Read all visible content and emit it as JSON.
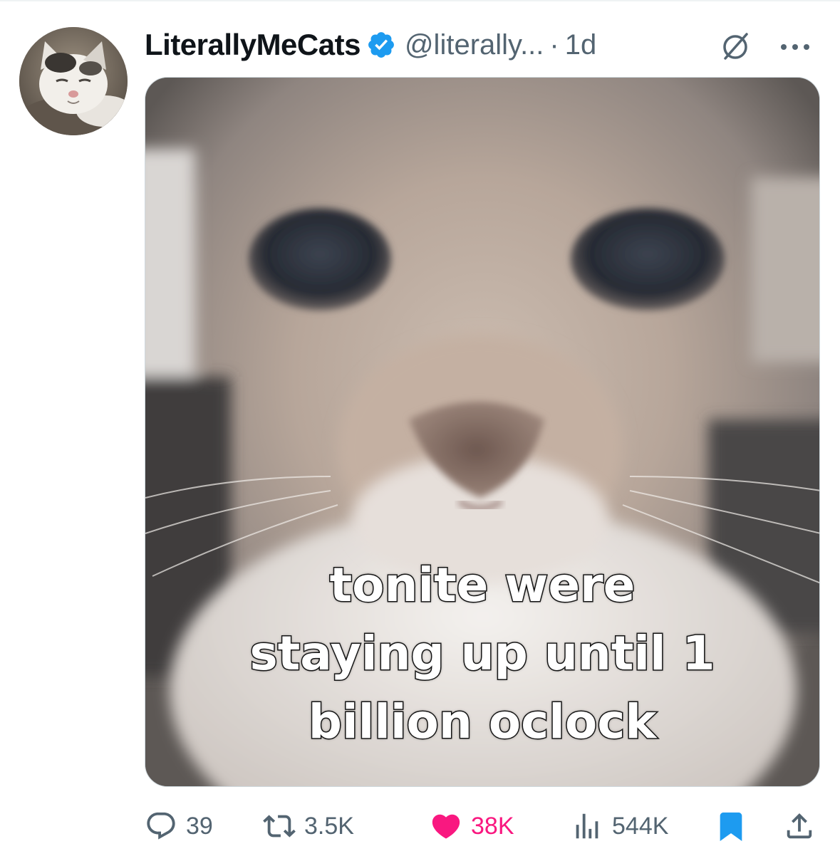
{
  "tweet": {
    "display_name": "LiterallyMeCats",
    "handle": "@literally...",
    "separator": "·",
    "time": "1d",
    "media_caption_lines": [
      "tonite were",
      "staying up until 1",
      "billion oclock"
    ]
  },
  "icons": {
    "verified": "verified-badge-icon",
    "grok": "grok-icon",
    "more": "more-options-icon",
    "reply": "reply-icon",
    "retweet": "retweet-icon",
    "like": "like-icon",
    "views": "views-icon",
    "bookmark": "bookmark-icon",
    "share": "share-icon"
  },
  "actions": {
    "replies": "39",
    "retweets": "3.5K",
    "likes": "38K",
    "views": "544K"
  },
  "state": {
    "liked": true,
    "bookmarked": true
  },
  "colors": {
    "text_primary": "#0f1419",
    "text_secondary": "#536471",
    "verified_blue": "#1d9bf0",
    "like_pink": "#f91880",
    "bookmark_blue": "#1d9bf0"
  }
}
